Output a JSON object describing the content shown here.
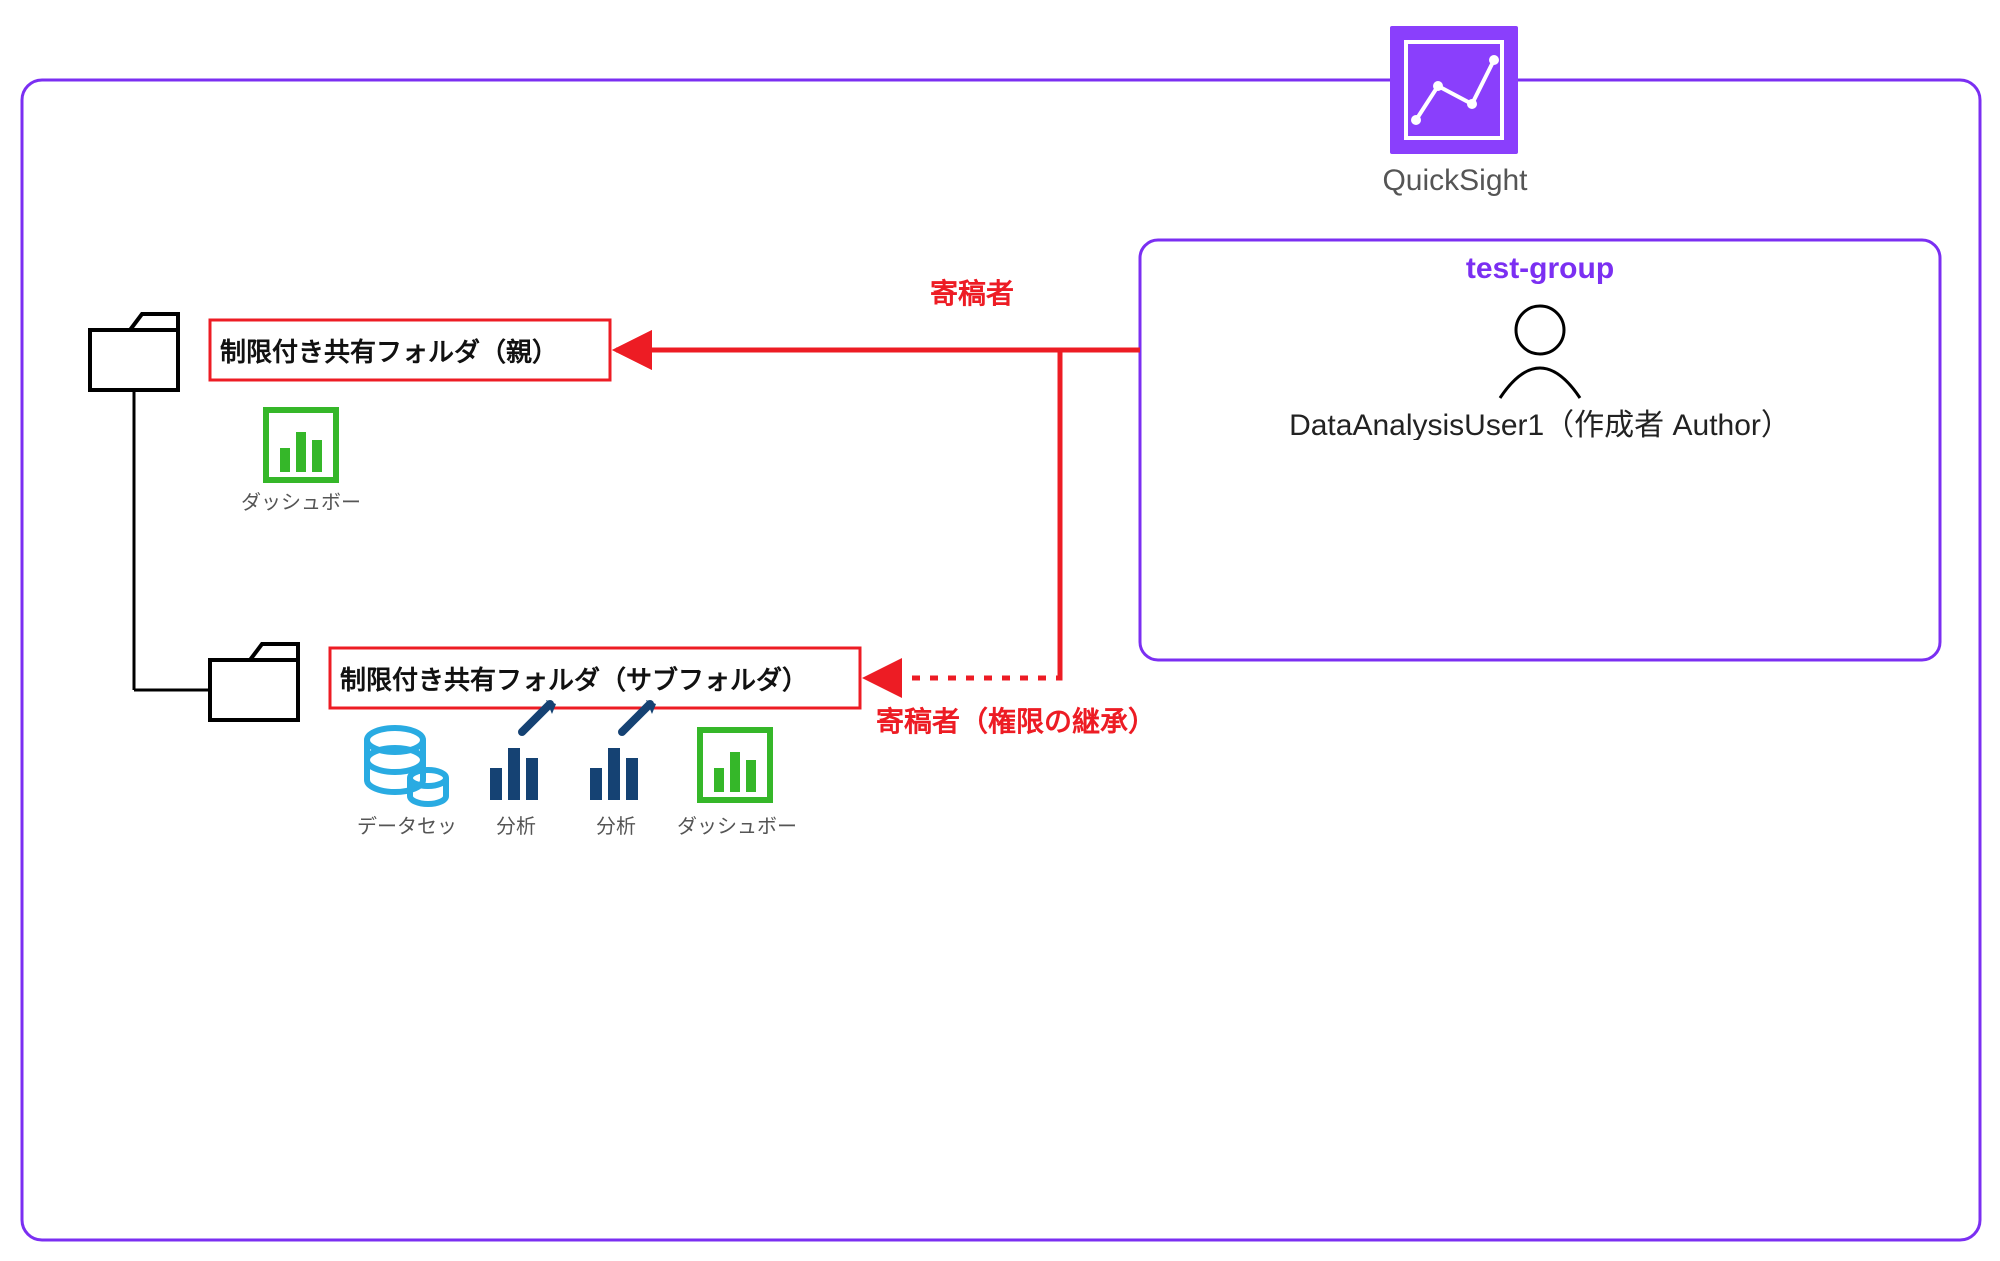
{
  "quicksight": {
    "title": "QuickSight"
  },
  "group": {
    "name": "test-group",
    "user": "DataAnalysisUser1（作成者 Author）"
  },
  "relations": {
    "r1": "寄稿者",
    "r2": "寄稿者（権限の継承）"
  },
  "folders": {
    "parent": "制限付き共有フォルダ（親）",
    "sub": "制限付き共有フォルダ（サブフォルダ）"
  },
  "assets": {
    "dashboard": "ダッシュボード",
    "dataset": "データセット",
    "analysis": "分析"
  },
  "colors": {
    "purple": "#7B2FF2",
    "red": "#ED1C24",
    "green": "#35B729",
    "navy": "#154273",
    "cyan": "#29ABE2",
    "black": "#000000",
    "gray": "#555555"
  }
}
